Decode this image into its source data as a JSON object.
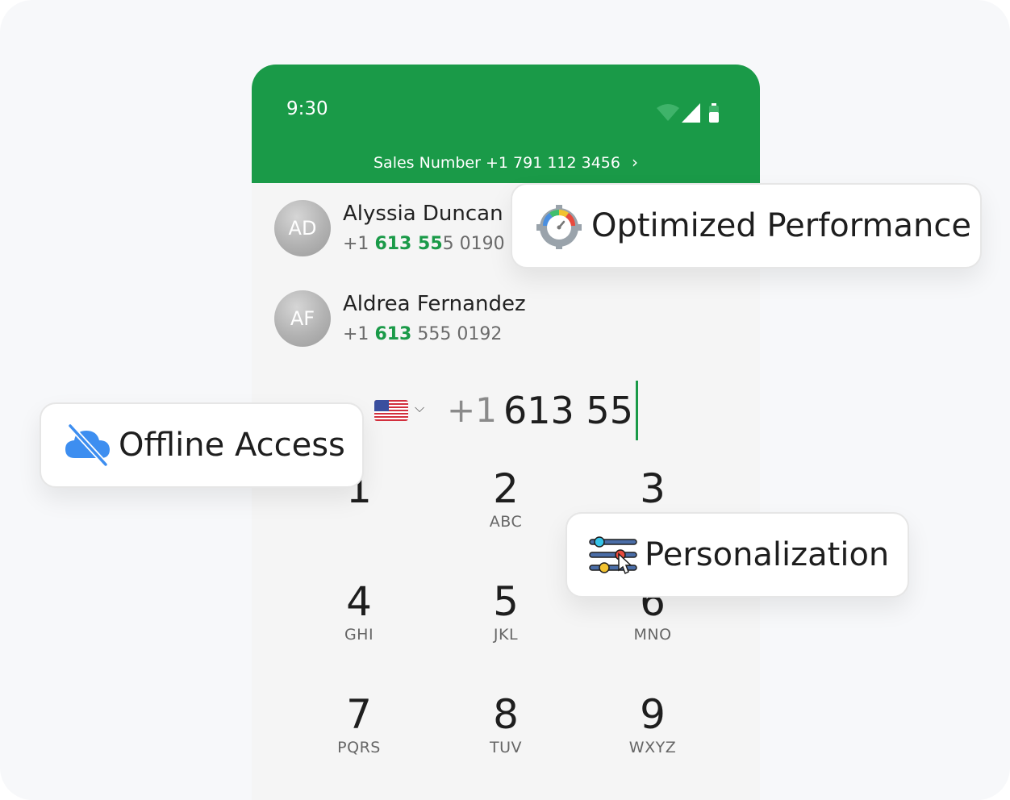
{
  "status": {
    "time": "9:30",
    "icons": [
      "wifi-icon",
      "signal-icon",
      "battery-icon"
    ]
  },
  "header": {
    "sales_label": "Sales Number +1 791 112 3456",
    "chevron": "chevron-right-icon",
    "color": "#1a9a48"
  },
  "contacts": [
    {
      "initials": "AD",
      "name": "Alyssia Duncan",
      "phone_prefix": "+1 ",
      "phone_match": "613 55",
      "phone_rest": "5 0190"
    },
    {
      "initials": "AF",
      "name": "Aldrea Fernandez",
      "phone_prefix": "+1 ",
      "phone_match": "613",
      "phone_rest": " 555 0192"
    }
  ],
  "dialer": {
    "country_flag": "us-flag-icon",
    "country_code": "+1",
    "typed_number": "613 55",
    "keys": [
      {
        "num": "1",
        "letters": ""
      },
      {
        "num": "2",
        "letters": "ABC"
      },
      {
        "num": "3",
        "letters": ""
      },
      {
        "num": "4",
        "letters": "GHI"
      },
      {
        "num": "5",
        "letters": "JKL"
      },
      {
        "num": "6",
        "letters": "MNO"
      },
      {
        "num": "7",
        "letters": "PQRS"
      },
      {
        "num": "8",
        "letters": "TUV"
      },
      {
        "num": "9",
        "letters": "WXYZ"
      }
    ]
  },
  "features": {
    "performance": {
      "label": "Optimized Performance",
      "icon": "speedometer-gear-icon"
    },
    "offline": {
      "label": "Offline Access",
      "icon": "cloud-off-icon"
    },
    "personalization": {
      "label": "Personalization",
      "icon": "sliders-icon"
    }
  },
  "colors": {
    "accent": "#1a9a48",
    "background": "#f7f8fa"
  }
}
